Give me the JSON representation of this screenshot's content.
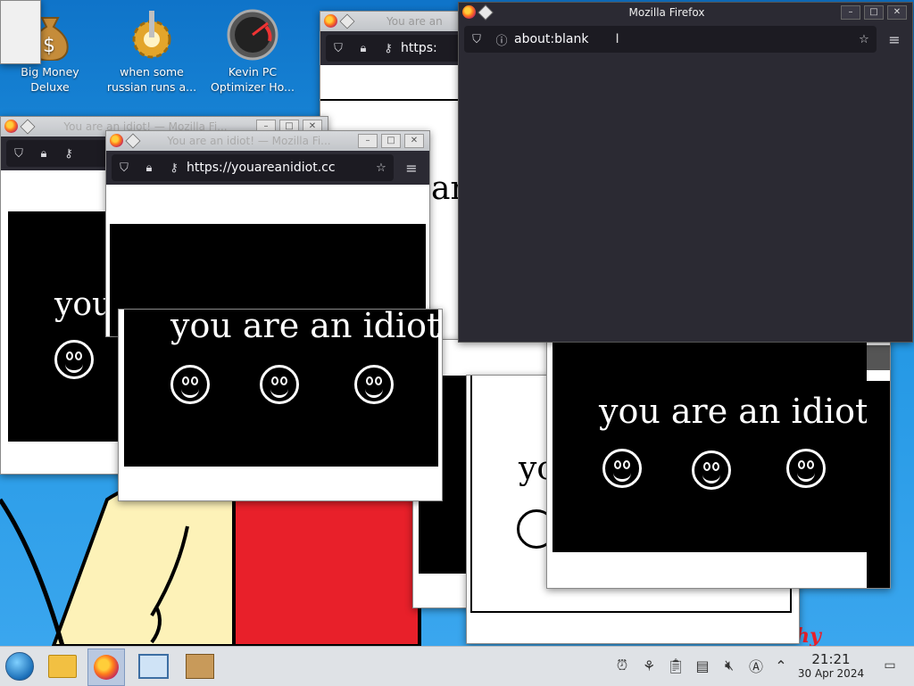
{
  "desktop": {
    "icons": [
      {
        "label": "Big Money Deluxe",
        "icon": "money-bag-icon"
      },
      {
        "label": "when some russian runs a...",
        "icon": "gear-icon"
      },
      {
        "label": "Kevin PC Optimizer Ho...",
        "icon": "gauge-icon"
      }
    ],
    "wallpaper_text": "sketchy"
  },
  "windows": {
    "back_title": "You are an idiot! — Mozilla Fi...",
    "back_title_short": "You are an",
    "idiot_title": "You are an idiot! — Mozilla Fi...",
    "url_youare": "https://youareanidiot.cc",
    "url_short": "https:",
    "front_title": "Mozilla Firefox",
    "front_url": "about:blank",
    "idiot_text": "you are an idiot",
    "idiot_text_partial": "you",
    "idiot_text_ar": "ar",
    "idiot_text_yo": "yo"
  },
  "taskbar": {
    "apps": [
      "start-menu-icon",
      "file-manager-icon",
      "firefox-icon",
      "remote-desktop-icon",
      "package-icon"
    ],
    "tray": [
      "alarm-icon",
      "kde-connect-icon",
      "clipboard-icon",
      "printer-icon",
      "volume-muted-icon",
      "input-icon",
      "chevron-up-icon"
    ],
    "time": "21:21",
    "date": "30 Apr 2024"
  },
  "colors": {
    "firefox_dark": "#2b2a33",
    "taskbar": "#dfe2e6",
    "wallpaper": "#1a84d2"
  }
}
